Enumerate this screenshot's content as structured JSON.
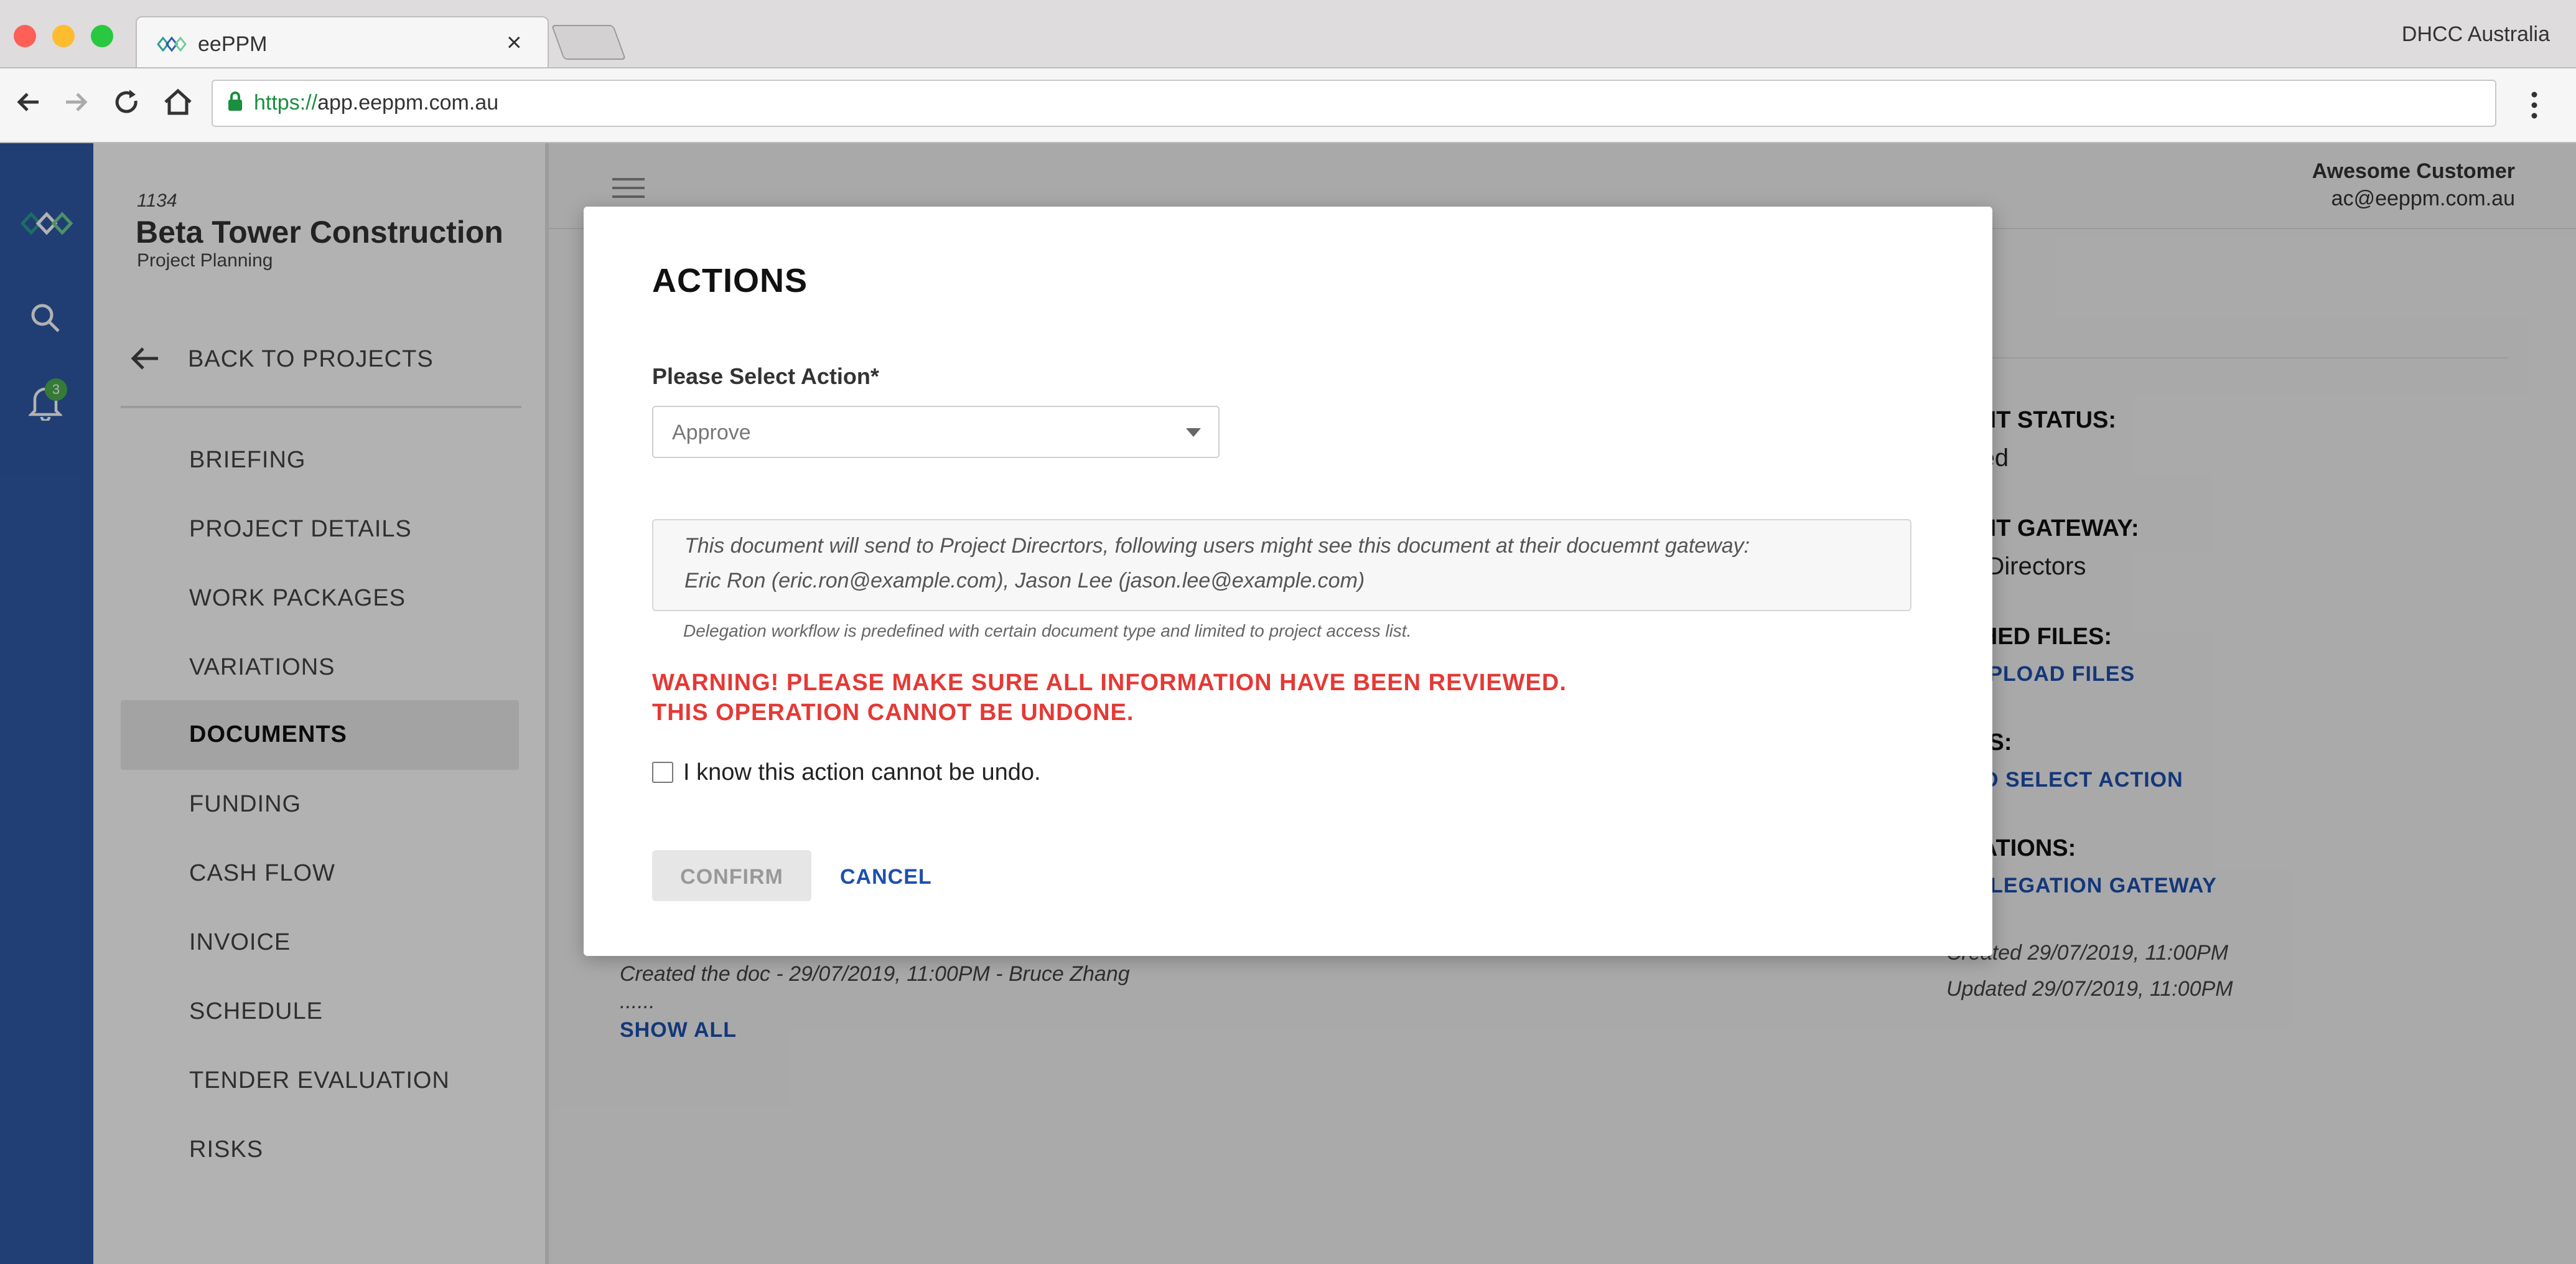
{
  "browser": {
    "tab_title": "eePPM",
    "profile": "DHCC Australia",
    "url_protocol": "https://",
    "url_host": "app.eeppm.com.au"
  },
  "rail": {
    "notification_count": "3"
  },
  "project": {
    "number": "1134",
    "name": "Beta Tower Construction",
    "subtitle": "Project Planning",
    "back_label": "BACK TO PROJECTS"
  },
  "sidebar": {
    "items": [
      {
        "label": "BRIEFING"
      },
      {
        "label": "PROJECT DETAILS"
      },
      {
        "label": "WORK PACKAGES"
      },
      {
        "label": "VARIATIONS"
      },
      {
        "label": "DOCUMENTS",
        "active": true
      },
      {
        "label": "FUNDING"
      },
      {
        "label": "CASH FLOW"
      },
      {
        "label": "INVOICE"
      },
      {
        "label": "SCHEDULE"
      },
      {
        "label": "TENDER EVALUATION"
      },
      {
        "label": "RISKS"
      }
    ]
  },
  "user": {
    "name": "Awesome Customer",
    "email": "ac@eeppm.com.au"
  },
  "details": {
    "status_heading": "RENT STATUS:",
    "status_value": "roved",
    "gateway_heading": "RENT GATEWAY:",
    "gateway_value": "ect Directors",
    "files_heading": "ACHED FILES:",
    "files_link": "/ / UPLOAD FILES",
    "actions_heading": "IONS:",
    "actions_link": "K TO SELECT ACTION",
    "delegations_heading": "EGATIONS:",
    "delegations_link": "/ DELEGATION GATEWAY",
    "created": "Created 29/07/2019, 11:00PM",
    "updated": "Updated 29/07/2019, 11:00PM"
  },
  "log": {
    "line1": "Created the doc - 29/07/2019, 11:00PM - Bruce Zhang",
    "ellipsis": "......",
    "show_all": "SHOW ALL"
  },
  "modal": {
    "title": "ACTIONS",
    "select_label": "Please Select Action*",
    "select_value": "Approve",
    "info_line1": "This document will send to Project Direcrtors, following users might see this document at their docuemnt gateway:",
    "info_line2": "Eric Ron (eric.ron@example.com), Jason Lee (jason.lee@example.com)",
    "hint": "Delegation workflow is predefined with certain document type and limited to project access list.",
    "warning_line1": "WARNING! PLEASE MAKE SURE ALL INFORMATION HAVE BEEN REVIEWED.",
    "warning_line2": "THIS OPERATION CANNOT BE UNDONE.",
    "checkbox_label": "I know this action cannot be undo.",
    "confirm_label": "CONFIRM",
    "cancel_label": "CANCEL"
  },
  "colors": {
    "rail": "#2f5aa6",
    "link": "#1d4fae",
    "warning": "#e53935"
  }
}
